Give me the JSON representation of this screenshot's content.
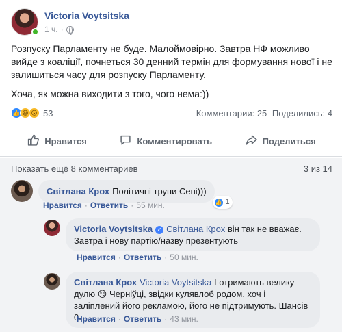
{
  "post": {
    "author": "Victoria Voytsitska",
    "time": "1 ч.",
    "paragraphs": [
      "Розпуску Парламенту не буде. Малоймовірно. Завтра НФ можливо вийде з коаліції, почнеться 30 денний термін для формування нової і не залишиться часу для розпуску Парламенту.",
      "Хоча, як можна виходити з того, чого нема:))"
    ]
  },
  "reactions": {
    "count": "53",
    "comments": "Комментарии: 25",
    "shares": "Поделились: 4"
  },
  "actions": {
    "like": "Нравится",
    "comment": "Комментировать",
    "share": "Поделиться"
  },
  "comments_area": {
    "show_more": "Показать ещё 8 комментариев",
    "pager": "3 из 14"
  },
  "comments": [
    {
      "author": "Світлана Крох",
      "text": "Політичні трупи Сені)))",
      "like": "Нравится",
      "reply": "Ответить",
      "time": "55 мин.",
      "reactions": "1"
    },
    {
      "author": "Victoria Voytsitska",
      "mention": "Світлана Крох",
      "text": "він так не вважає. Завтра і нову партію/назву презентують",
      "like": "Нравится",
      "reply": "Ответить",
      "time": "50 мин."
    },
    {
      "author": "Світлана Крох",
      "mention": "Victoria Voytsitska",
      "text1": "І отримають велику дулю",
      "text2": "Черніўці, звідки кулявлоб родом, хоч і заліплений його рекламою, його не підтримують. Шансів 0.",
      "like": "Нравится",
      "reply": "Ответить",
      "time": "43 мин."
    }
  ],
  "colors": {
    "link": "#385898",
    "like_blue": "#2d88ff",
    "online": "#42b72a"
  }
}
